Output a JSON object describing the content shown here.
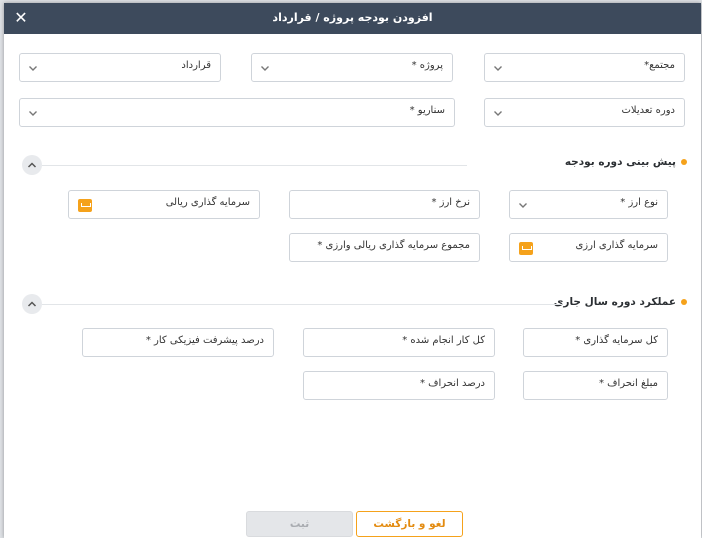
{
  "dialog": {
    "title": "افزودن بودجه پروژه / قرارداد",
    "close_label": "✕"
  },
  "top_fields": {
    "complex": "مجتمع*",
    "project": "پروژه *",
    "contract": "قرارداد",
    "adjustment_period": "دوره تعدیلات",
    "scenario": "سناریو *"
  },
  "forecast_section": {
    "title": "پیش بینی دوره بودجه",
    "currency_type": "نوع ارز *",
    "exchange_rate": "نرخ ارز *",
    "rial_investment": "سرمایه گذاری ریالی",
    "currency_investment": "سرمایه گذاری ارزی",
    "total_investment": "مجموع سرمایه گذاری ریالی وارزی *"
  },
  "performance_section": {
    "title": "عملکرد دوره سال جاری",
    "total_investment": "کل سرمایه گذاری *",
    "total_work_done": "کل کار انجام شده *",
    "physical_progress_percent": "درصد پیشرفت فیزیکی کار *",
    "deviation_amount": "مبلغ انحراف *",
    "deviation_percent": "درصد انحراف *"
  },
  "buttons": {
    "cancel": "لغو و بازگشت",
    "submit": "ثبت"
  },
  "colors": {
    "header_bg": "#3d4a5c",
    "accent": "#f5a21b",
    "border": "#cfd4da"
  }
}
